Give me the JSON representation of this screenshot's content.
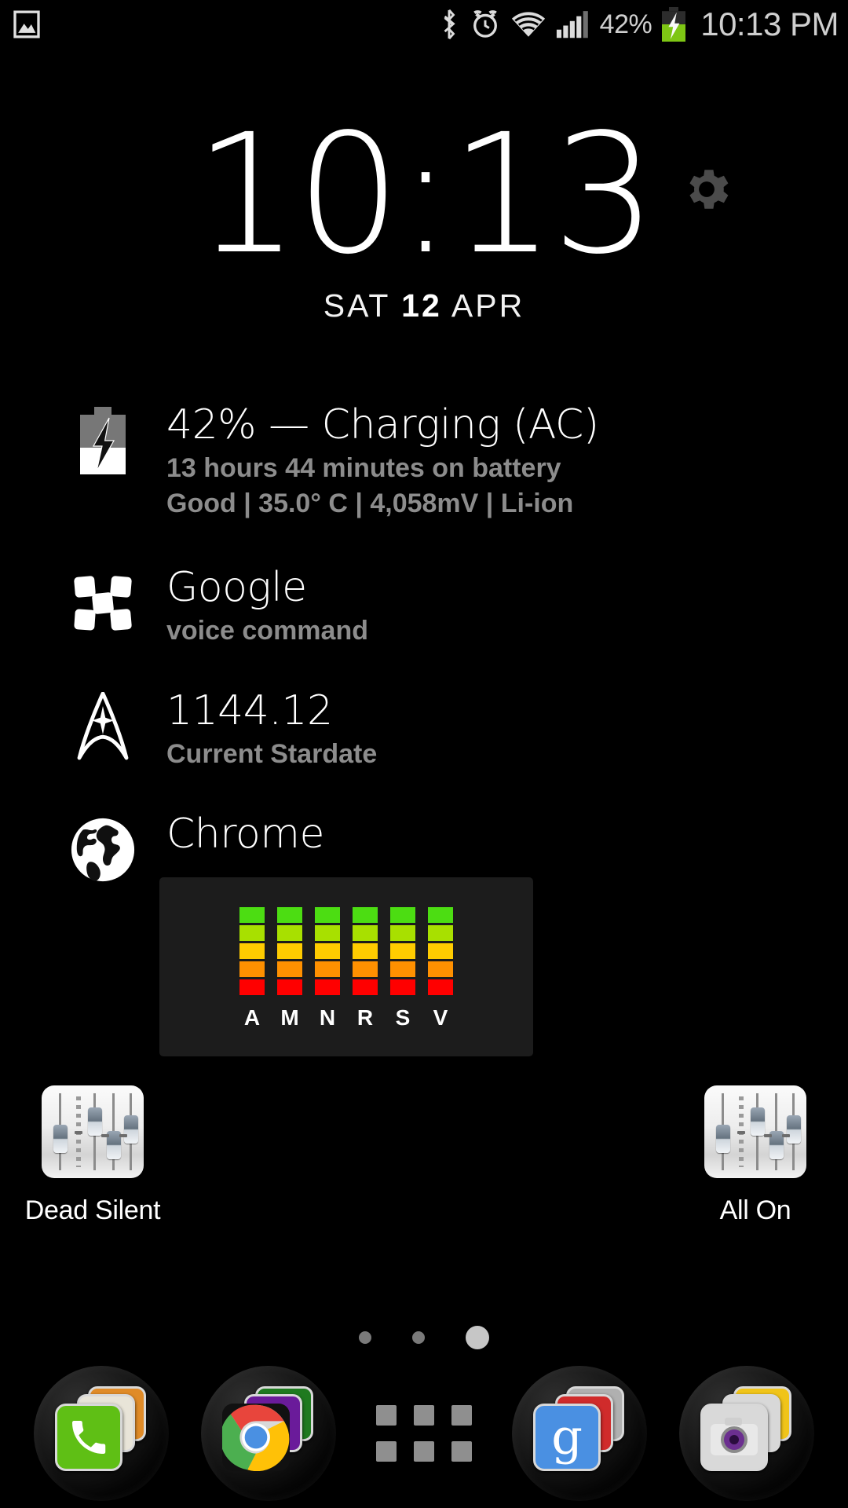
{
  "status_bar": {
    "left_icons": [
      {
        "name": "image-notification-icon",
        "glyph": "image"
      }
    ],
    "right_icons": [
      {
        "name": "bluetooth-icon"
      },
      {
        "name": "alarm-icon"
      },
      {
        "name": "wifi-icon"
      },
      {
        "name": "signal-icon"
      }
    ],
    "battery_percent": "42%",
    "battery_state": "charging",
    "clock": "10:13 PM"
  },
  "clock_widget": {
    "time": "10:13",
    "date_weekday": "SAT",
    "date_day": "12",
    "date_month": "APR",
    "settings_icon": "gear-icon"
  },
  "notifications": [
    {
      "id": "battery",
      "icon": "battery-charging-icon",
      "title": "42% — Charging (AC)",
      "sub_lines": [
        "13 hours 44 minutes on battery",
        "Good | 35.0° C | 4,058mV | Li-ion"
      ]
    },
    {
      "id": "google",
      "icon": "google-now-icon",
      "title": "Google",
      "sub_lines": [
        "voice command"
      ]
    },
    {
      "id": "stardate",
      "icon": "starfleet-delta-icon",
      "title": "1144.12",
      "sub_lines": [
        "Current Stardate"
      ]
    },
    {
      "id": "chrome",
      "icon": "globe-icon",
      "title": "Chrome",
      "sub_lines": [
        ""
      ]
    }
  ],
  "shortcuts": {
    "left": {
      "label": "Dead Silent",
      "icon": "volume-sliders-icon"
    },
    "right": {
      "label": "All On",
      "icon": "volume-sliders-icon"
    }
  },
  "chart_data": {
    "type": "bar",
    "title": "",
    "categories": [
      "A",
      "M",
      "N",
      "R",
      "S",
      "V"
    ],
    "values": [
      5,
      5,
      5,
      5,
      5,
      5
    ],
    "ylim": [
      0,
      5
    ],
    "xlabel": "",
    "ylabel": "",
    "grid": false,
    "legend": "none",
    "segment_colors": [
      "#ff0000",
      "#ff9000",
      "#ffcc00",
      "#a8e000",
      "#4cdd12"
    ],
    "note": "Six volume-stream level meters, each showing 5 lit segments (full)."
  },
  "page_indicator": {
    "count": 3,
    "active_index": 2
  },
  "dock": {
    "items": [
      {
        "name": "phone-dock-icon",
        "colors": [
          "#5fbf15",
          "#e8e4d8",
          "#e08b28"
        ]
      },
      {
        "name": "chrome-dock-icon",
        "colors": [
          "#dd4b3e",
          "#6a1b9a",
          "#1f7a1f"
        ]
      },
      {
        "name": "app-drawer-button",
        "colors": []
      },
      {
        "name": "google-search-dock-icon",
        "colors": [
          "#4a90e2",
          "#d02b2b",
          "#b0b0b0"
        ]
      },
      {
        "name": "camera-dock-icon",
        "colors": [
          "#6b4a8f",
          "#f0c419",
          "#d8d8d8"
        ]
      }
    ]
  },
  "theme": {
    "background": "#000000",
    "title_text": "#ffffff",
    "sub_text": "#8c8c8c",
    "status_text": "#cfcfcf",
    "widget_bg": "#1c1c1c"
  }
}
